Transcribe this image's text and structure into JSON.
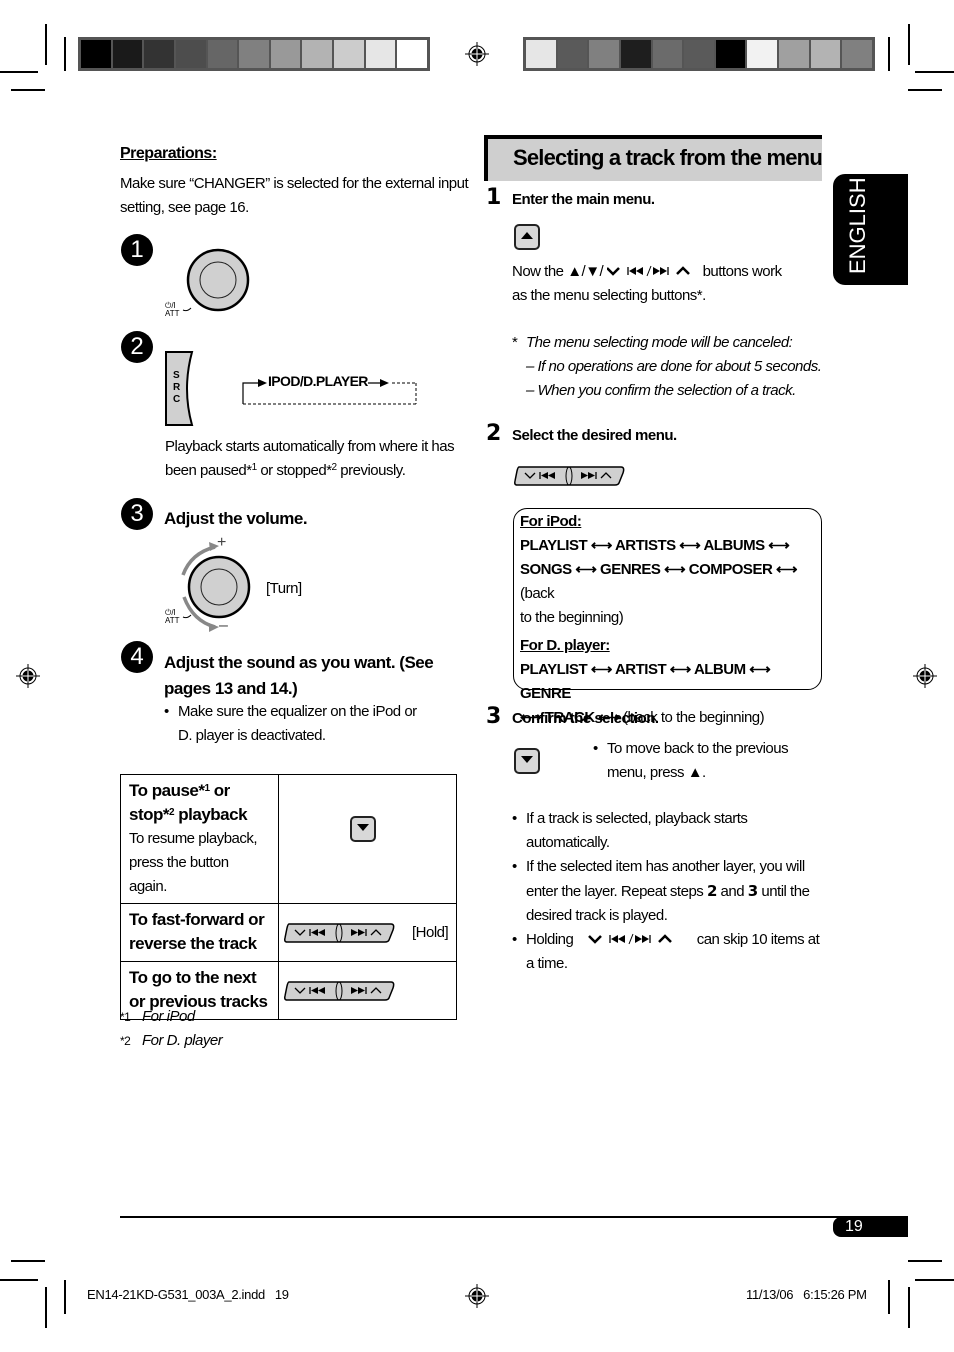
{
  "print_marks": {
    "left_strip_grays": [
      "#000000",
      "#1a1a1a",
      "#333333",
      "#4d4d4d",
      "#666666",
      "#808080",
      "#999999",
      "#b3b3b3",
      "#cccccc",
      "#e6e6e6",
      "#ffffff"
    ],
    "right_strip_grays": [
      "#e6e6e6",
      "#5a5a5a",
      "#808080",
      "#1e1e1e",
      "#6b6b6b",
      "#5a5a5a",
      "#000000",
      "#f2f2f2",
      "#a0a0a0",
      "#b3b3b3",
      "#808080"
    ]
  },
  "left": {
    "preparations": {
      "heading": "Preparations:",
      "text_line1": "Make sure “CHANGER” is selected for the external input",
      "text_line2": "setting, see page 16."
    },
    "step1": {
      "number": "1",
      "button_label_top": "⏻/I",
      "button_label_bottom": "ATT"
    },
    "step2": {
      "number": "2",
      "src_letters": [
        "S",
        "R",
        "C"
      ],
      "source_label": "IPOD/D.PLAYER",
      "text_line1": "Playback starts automatically from where it has",
      "text_line2_a": "been paused*",
      "sup1": "1",
      "text_line2_b": " or stopped*",
      "sup2": "2",
      "text_line2_c": " previously."
    },
    "step3": {
      "number": "3",
      "heading": "Adjust the volume.",
      "plus": "+",
      "minus": "–",
      "turn_label": "[Turn]",
      "button_label_top": "⏻/I",
      "button_label_bottom": "ATT"
    },
    "step4": {
      "number": "4",
      "heading_line1": "Adjust the sound as you want. (See",
      "heading_line2": "pages 13 and 14.)",
      "bullet_line1": "Make sure the equalizer on the iPod or",
      "bullet_line2": "D. player is deactivated."
    },
    "table": {
      "rows": [
        {
          "title_a": "To pause*",
          "sup_a": "1",
          "title_b": " or",
          "title_c": "stop*",
          "sup_c": "2",
          "title_d": " playback",
          "desc_line1": "To resume playback,",
          "desc_line2": "press the button again.",
          "control": "down-button"
        },
        {
          "title_line1": "To fast-forward or",
          "title_line2": "reverse the track",
          "control": "skip-rocker",
          "hint": "[Hold]"
        },
        {
          "title_line1": "To go to the next",
          "title_line2": "or previous tracks",
          "control": "skip-rocker"
        }
      ]
    },
    "footnotes": [
      {
        "mark": "*1",
        "text": "For iPod"
      },
      {
        "mark": "*2",
        "text": "For D. player"
      }
    ]
  },
  "right": {
    "section_title": "Selecting a track from the menu",
    "language_tab": "ENGLISH",
    "step1": {
      "number": "1",
      "heading": "Enter the main menu.",
      "text_a": "Now the ▲/▼/",
      "text_b": " buttons work",
      "text_line2": "as the menu selecting buttons*.",
      "note_line1": "The menu selecting mode will be canceled:",
      "note_line2": "– If no operations are done for about 5 seconds.",
      "note_line3": "– When you confirm the selection of a track.",
      "note_mark": "*"
    },
    "step2": {
      "number": "2",
      "heading": "Select the desired menu.",
      "ipod_heading": "For iPod:",
      "ipod_line1": [
        "PLAYLIST",
        "ARTISTS",
        "ALBUMS"
      ],
      "ipod_line2": [
        "SONGS",
        "GENRES",
        "COMPOSER"
      ],
      "ipod_back_a": "(back",
      "ipod_back_b": "to the beginning)",
      "dplayer_heading": "For D. player:",
      "dplayer_line1": [
        "PLAYLIST",
        "ARTIST",
        "ALBUM",
        "GENRE"
      ],
      "dplayer_line2": [
        "TRACK"
      ],
      "dplayer_back": "(back to the beginning)",
      "arrow": "⟷"
    },
    "step3": {
      "number": "3",
      "heading": "Confirm the selection.",
      "bullet_line1": "To move back to the previous",
      "bullet_line2": "menu, press ▲.",
      "bullets": [
        {
          "line1": "If a track is selected, playback starts",
          "line2": "automatically."
        },
        {
          "line1": "If the selected item has another layer, you will",
          "line2_a": "enter the layer. Repeat steps ",
          "b1": "2",
          "line2_b": " and ",
          "b2": "3",
          "line2_c": " until the",
          "line3": "desired track is played."
        },
        {
          "line1_a": "Holding ",
          "line1_b": " can skip 10 items at",
          "line2": "a time."
        }
      ]
    }
  },
  "footer": {
    "page_number": "19",
    "file_info": "EN14-21KD-G531_003A_2.indd   19",
    "timestamp": "11/13/06   6:15:26 PM"
  }
}
